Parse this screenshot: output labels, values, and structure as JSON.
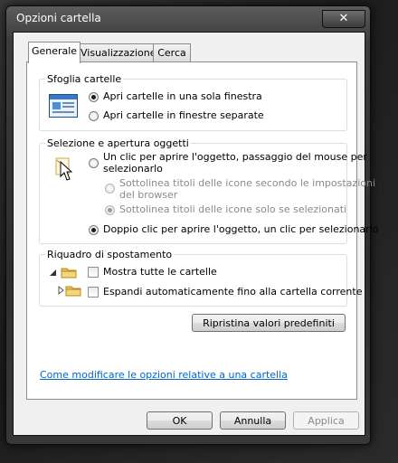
{
  "window": {
    "title": "Opzioni cartella",
    "close_glyph": "✕"
  },
  "tabs": [
    {
      "label": "Generale"
    },
    {
      "label": "Visualizzazione"
    },
    {
      "label": "Cerca"
    }
  ],
  "browse": {
    "group_label": "Sfoglia cartelle",
    "options": [
      {
        "label": "Apri cartelle in una sola finestra",
        "selected": true
      },
      {
        "label": "Apri cartelle in finestre separate",
        "selected": false
      }
    ]
  },
  "click": {
    "group_label": "Selezione e apertura oggetti",
    "single_click_line1": "Un clic per aprire l'oggetto, passaggio del mouse per",
    "single_click_line2": "selezionarlo",
    "underline_browser_line1": "Sottolinea titoli delle icone secondo le impostazioni",
    "underline_browser_line2": "del browser",
    "underline_hover": "Sottolinea titoli delle icone solo se selezionati",
    "double_click": "Doppio clic per aprire l'oggetto, un clic per selezionarlo"
  },
  "nav": {
    "group_label": "Riquadro di spostamento",
    "show_all_folders": "Mostra tutte le cartelle",
    "auto_expand": "Espandi automaticamente fino alla cartella corrente"
  },
  "restore_label": "Ripristina valori predefiniti",
  "help_link": "Come modificare le opzioni relative a una cartella",
  "buttons": {
    "ok": "OK",
    "cancel": "Annulla",
    "apply": "Applica"
  },
  "colors": {
    "accent": "#3c7fb1",
    "link": "#0066cc"
  }
}
